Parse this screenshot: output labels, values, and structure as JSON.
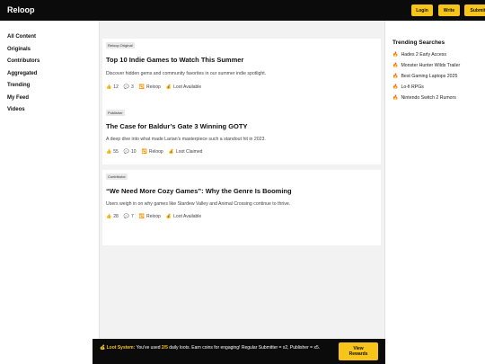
{
  "header": {
    "brand": "Reloop",
    "login_label": "Login",
    "write_label": "Write",
    "submit_label": "Submit"
  },
  "nav": {
    "items": [
      "All Content",
      "Originals",
      "Contributors",
      "Aggregated",
      "Trending",
      "My Feed",
      "Videos"
    ]
  },
  "feed": {
    "cards": [
      {
        "tag": "Reloop Original",
        "title": "Top 10 Indie Games to Watch This Summer",
        "desc": "Discover hidden gems and community favorites in our summer indie spotlight.",
        "likes": "12",
        "comments": "3",
        "reloop": "Reloop",
        "loot": "Loot Available"
      },
      {
        "tag": "Publisher",
        "title": "The Case for Baldur’s Gate 3 Winning GOTY",
        "desc": "A deep dive into what made Larian’s masterpiece such a standout hit in 2023.",
        "likes": "55",
        "comments": "10",
        "reloop": "Reloop",
        "loot": "Loot Claimed"
      },
      {
        "tag": "Contributor",
        "title": "“We Need More Cozy Games”: Why the Genre Is Booming",
        "desc": "Users weigh in on why games like Stardew Valley and Animal Crossing continue to thrive.",
        "likes": "28",
        "comments": "7",
        "reloop": "Reloop",
        "loot": "Loot Available"
      }
    ]
  },
  "trending": {
    "heading": "Trending Searches",
    "items": [
      "Hades 2 Early Access",
      "Monster Hunter Wilds Trailer",
      "Best Gaming Laptops 2025",
      "Lo-fi RPGs",
      "Nintendo Switch 2 Rumors"
    ]
  },
  "banner": {
    "label": "Loot System:",
    "text_before": "You've used",
    "used": "2/5",
    "text_after": "daily loots. Earn coins for engaging! Regular Submitter = x2, Publisher = x5.",
    "button_line1": "View",
    "button_line2": "Rewards"
  },
  "icons": {
    "like": "thumbs-up-icon",
    "comment": "speech-bubble-icon",
    "reloop": "repeat-icon",
    "loot": "money-bag-icon",
    "trending": "fire-icon"
  },
  "colors": {
    "accent": "#f7c41a",
    "header_bg": "#0b0b0b",
    "feed_bg": "#f2f2f2"
  }
}
